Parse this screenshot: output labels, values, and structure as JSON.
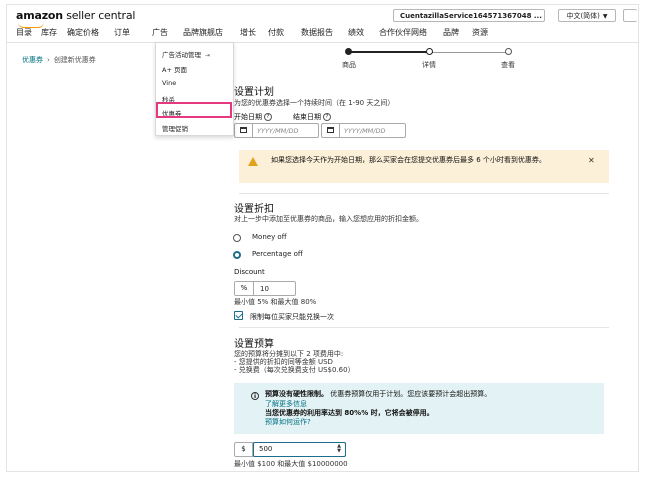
{
  "header": {
    "logo_bold": "amazon",
    "logo_rest": " seller central",
    "account": "CuentazillaService164571367048 ...",
    "language": "中文(简体)"
  },
  "nav": [
    "目录",
    "库存",
    "确定价格",
    "订单",
    "广告",
    "品牌旗舰店",
    "增长",
    "付款",
    "数据报告",
    "绩效",
    "合作伙伴网络",
    "品牌",
    "资源"
  ],
  "breadcrumb": {
    "parent": "优惠券",
    "current": "创建新优惠券"
  },
  "steps": [
    "商品",
    "详情",
    "查看"
  ],
  "ads_menu": [
    "广告活动管理",
    "A+ 页面",
    "Vine",
    "秒杀",
    "优惠券",
    "管理促销"
  ],
  "schedule": {
    "title": "设置计划",
    "desc": "为您的优惠券选择一个持续时间（在 1-90 天之间）",
    "start_label": "开始日期",
    "end_label": "结束日期",
    "date_placeholder": "YYYY/MM/DD",
    "warning": "如果您选择今天作为开始日期，那么买家会在您提交优惠券后最多 6 个小时看到优惠券。"
  },
  "discount": {
    "title": "设置折扣",
    "desc": "对上一步中添加至优惠券的商品，输入您想应用的折扣金额。",
    "option_money": "Money off",
    "option_percent": "Percentage off",
    "selected": "Percentage off",
    "field_label": "Discount",
    "prefix": "%",
    "value": "10",
    "hint": "最小值 5% 和最大值 80%",
    "limit_label": "限制每位买家只能兑换一次",
    "limit_checked": true
  },
  "budget": {
    "title": "设置预算",
    "desc": "您的预算将分摊到以下 2 项费用中:",
    "item1": "- 您提供的折扣的同等金额 USD",
    "item2": "- 兑换费（每次兑换费支付 US$0.60）",
    "info_bold": "预算没有硬性限制。",
    "info_rest": "优惠券预算仅用于计划。您应该要预计会超出预算。",
    "learn_more": "了解更多信息",
    "stop_note": "当您优惠券的利用率达到 80%% 时，它将会被停用。",
    "how_link": "预算如何运作?",
    "prefix": "$",
    "value": "500",
    "hint": "最小值 $100 和最大值 $10000000"
  },
  "colors": {
    "highlight": "#e5387e",
    "link": "#007185",
    "warning_bg": "#fcf1d8",
    "info_bg": "#e3f2f4"
  }
}
